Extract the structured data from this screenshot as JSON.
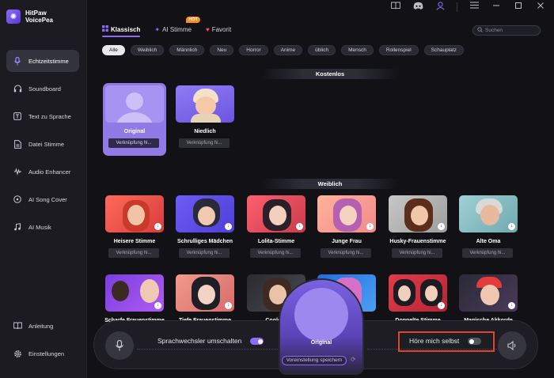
{
  "brand": {
    "line1": "HitPaw",
    "line2": "VoicePea"
  },
  "sidebar": {
    "items": [
      {
        "label": "Echtzeitstimme",
        "icon": "mic-icon",
        "active": true
      },
      {
        "label": "Soundboard",
        "icon": "headphones-icon",
        "active": false
      },
      {
        "label": "Text zu Sprache",
        "icon": "text-icon",
        "active": false
      },
      {
        "label": "Datei Stimme",
        "icon": "file-icon",
        "active": false
      },
      {
        "label": "Audio Enhancer",
        "icon": "enhance-icon",
        "active": false
      },
      {
        "label": "AI Song Cover",
        "icon": "disc-icon",
        "active": false
      },
      {
        "label": "AI Musik",
        "icon": "music-icon",
        "active": false
      }
    ],
    "bottom": [
      {
        "label": "Anleitung",
        "icon": "book-icon"
      },
      {
        "label": "Einstellungen",
        "icon": "gear-icon"
      }
    ]
  },
  "tabs": [
    {
      "label": "Klassisch",
      "active": true
    },
    {
      "label": "AI Stimme",
      "badge": "HOT"
    },
    {
      "label": "Favorit"
    }
  ],
  "search": {
    "placeholder": "Suchen"
  },
  "filters": [
    "Alle",
    "Weiblich",
    "Männlich",
    "Neu",
    "Horror",
    "Anime",
    "üblich",
    "Mensch",
    "Rollenspiel",
    "Schauplatz"
  ],
  "sections": {
    "free": "Kostenlos",
    "female": "Weiblich"
  },
  "shortcut_label_short": "Verknüpfung hi...",
  "shortcut_label": "Verknüpfung hinzufügen",
  "free_voices": [
    {
      "name": "Original",
      "selected": true
    },
    {
      "name": "Niedlich",
      "selected": false
    }
  ],
  "female_voices": [
    {
      "name": "Heisere Stimme"
    },
    {
      "name": "Schrulliges Mädchen"
    },
    {
      "name": "Lolita-Stimme"
    },
    {
      "name": "Junge Frau"
    },
    {
      "name": "Husky-Frauenstimme"
    },
    {
      "name": "Alte Oma"
    }
  ],
  "row3_voices": [
    {
      "name": "Scharfe Frauenstimme"
    },
    {
      "name": "Tiefe Frauenstimme"
    },
    {
      "name": "Coole M"
    },
    {
      "name": ""
    },
    {
      "name": "Doppelte Stimme"
    },
    {
      "name": "Magische Akkorde"
    }
  ],
  "bottombar": {
    "switch_label": "Sprachwechsler umschalten",
    "switch_on": true,
    "hear_self_label": "Höre mich selbst",
    "hear_self_on": false,
    "current_voice": "Original",
    "preset_button": "Voreinstellung speichern"
  }
}
